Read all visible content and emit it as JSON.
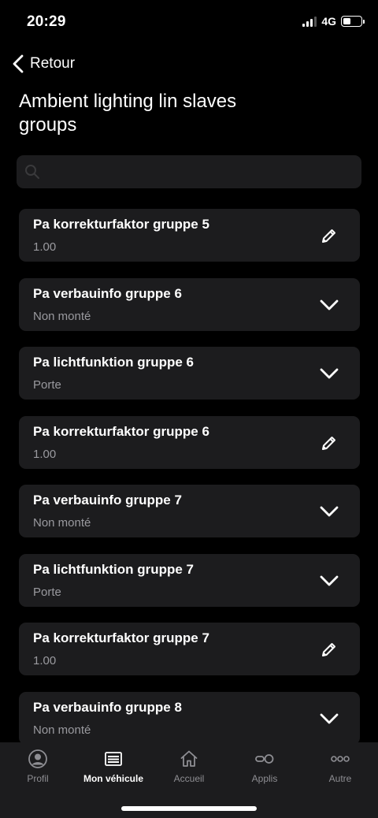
{
  "status": {
    "time": "20:29",
    "network": "4G"
  },
  "nav": {
    "back_label": "Retour"
  },
  "page": {
    "title": "Ambient lighting lin slaves groups"
  },
  "search": {
    "placeholder": "",
    "value": ""
  },
  "items": [
    {
      "title": "Pa korrekturfaktor gruppe 5",
      "value": "1.00",
      "icon": "pencil-icon"
    },
    {
      "title": "Pa verbauinfo gruppe 6",
      "value": "Non monté",
      "icon": "chevron-down-icon"
    },
    {
      "title": "Pa lichtfunktion gruppe 6",
      "value": "Porte",
      "icon": "chevron-down-icon"
    },
    {
      "title": "Pa korrekturfaktor gruppe 6",
      "value": "1.00",
      "icon": "pencil-icon"
    },
    {
      "title": "Pa verbauinfo gruppe 7",
      "value": "Non monté",
      "icon": "chevron-down-icon"
    },
    {
      "title": "Pa lichtfunktion gruppe 7",
      "value": "Porte",
      "icon": "chevron-down-icon"
    },
    {
      "title": "Pa korrekturfaktor gruppe 7",
      "value": "1.00",
      "icon": "pencil-icon"
    },
    {
      "title": "Pa verbauinfo gruppe 8",
      "value": "Non monté",
      "icon": "chevron-down-icon"
    }
  ],
  "tabbar": {
    "active": "Mon véhicule",
    "tabs": [
      {
        "label": "Profil",
        "icon": "profile-icon"
      },
      {
        "label": "Mon véhicule",
        "icon": "vehicle-icon"
      },
      {
        "label": "Accueil",
        "icon": "home-icon"
      },
      {
        "label": "Applis",
        "icon": "apps-icon"
      },
      {
        "label": "Autre",
        "icon": "more-icon"
      }
    ]
  },
  "colors": {
    "background": "#000000",
    "card": "#1c1c1e",
    "secondary_text": "#9a9a9f",
    "tab_inactive": "#8e8e93"
  }
}
